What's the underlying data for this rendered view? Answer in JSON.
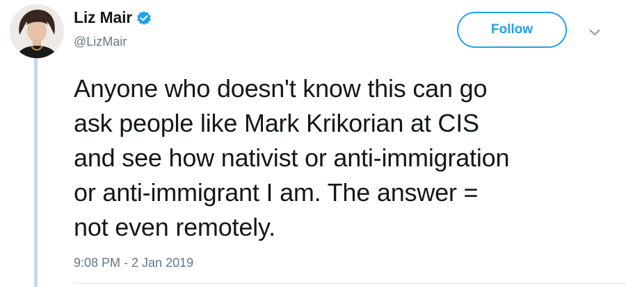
{
  "author": {
    "display_name": "Liz Mair",
    "handle": "@LizMair",
    "verified": true,
    "avatar_icon": "profile-photo"
  },
  "actions": {
    "follow_label": "Follow",
    "more_icon": "chevron-down-icon"
  },
  "tweet": {
    "text": "Anyone who doesn't know this can go\nask people like Mark Krikorian at CIS\nand see how nativist or anti-immigration\nor anti-immigrant I am. The answer =\nnot even remotely.",
    "timestamp": "9:08 PM - 2 Jan 2019"
  },
  "colors": {
    "accent": "#1da1f2",
    "text": "#14171a",
    "muted": "#657786",
    "thread_line": "#c4d8e8"
  }
}
